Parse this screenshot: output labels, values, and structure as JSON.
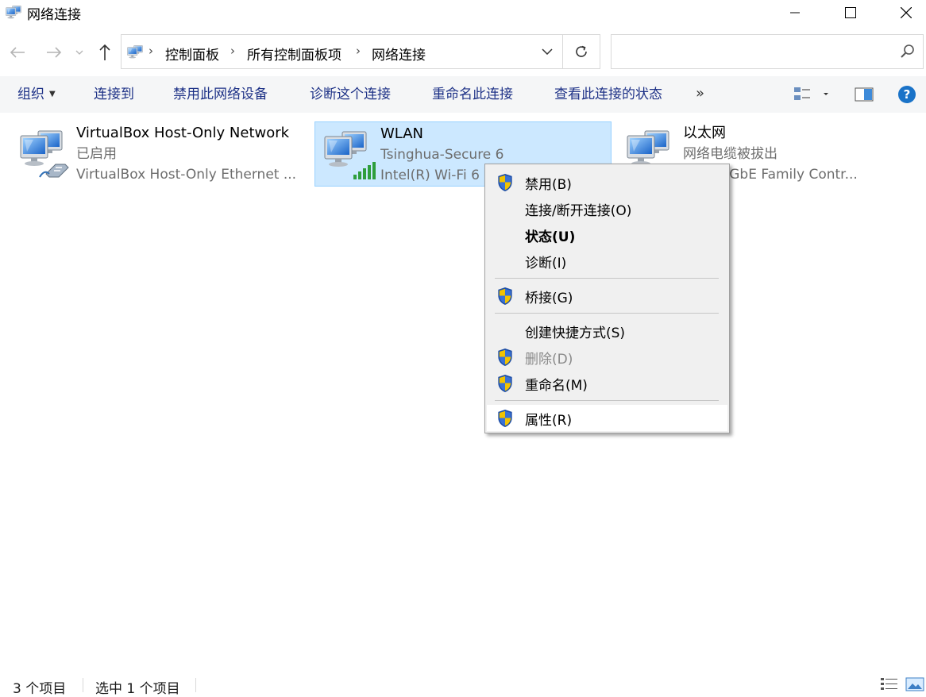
{
  "window": {
    "title": "网络连接"
  },
  "addressbar": {
    "crumbs": [
      "控制面板",
      "所有控制面板项",
      "网络连接"
    ]
  },
  "search": {
    "placeholder": "",
    "value": ""
  },
  "commandbar": {
    "organize": "组织",
    "connect_to": "连接到",
    "disable_device": "禁用此网络设备",
    "diagnose": "诊断这个连接",
    "rename": "重命名此连接",
    "view_status": "查看此连接的状态",
    "more": "»"
  },
  "items": [
    {
      "name": "VirtualBox Host-Only Network",
      "status": "已启用",
      "device": "VirtualBox Host-Only Ethernet ..."
    },
    {
      "name": "WLAN",
      "status": "Tsinghua-Secure 6",
      "device": "Intel(R) Wi-Fi 6"
    },
    {
      "name": "以太网",
      "status": "网络电缆被拔出",
      "device": "k PCIe GbE Family Contr..."
    }
  ],
  "context_menu": {
    "disable": "禁用(B)",
    "connect_disconnect": "连接/断开连接(O)",
    "status": "状态(U)",
    "diagnose": "诊断(I)",
    "bridge": "桥接(G)",
    "create_shortcut": "创建快捷方式(S)",
    "delete": "删除(D)",
    "rename": "重命名(M)",
    "properties": "属性(R)"
  },
  "statusbar": {
    "item_count": "3 个项目",
    "selected_count": "选中 1 个项目"
  },
  "colors": {
    "selection_bg": "#cce8ff",
    "selection_border": "#99d1ff",
    "command_text": "#1e3287",
    "help_blue": "#1a73c8",
    "signal_green": "#2e9e3c"
  }
}
